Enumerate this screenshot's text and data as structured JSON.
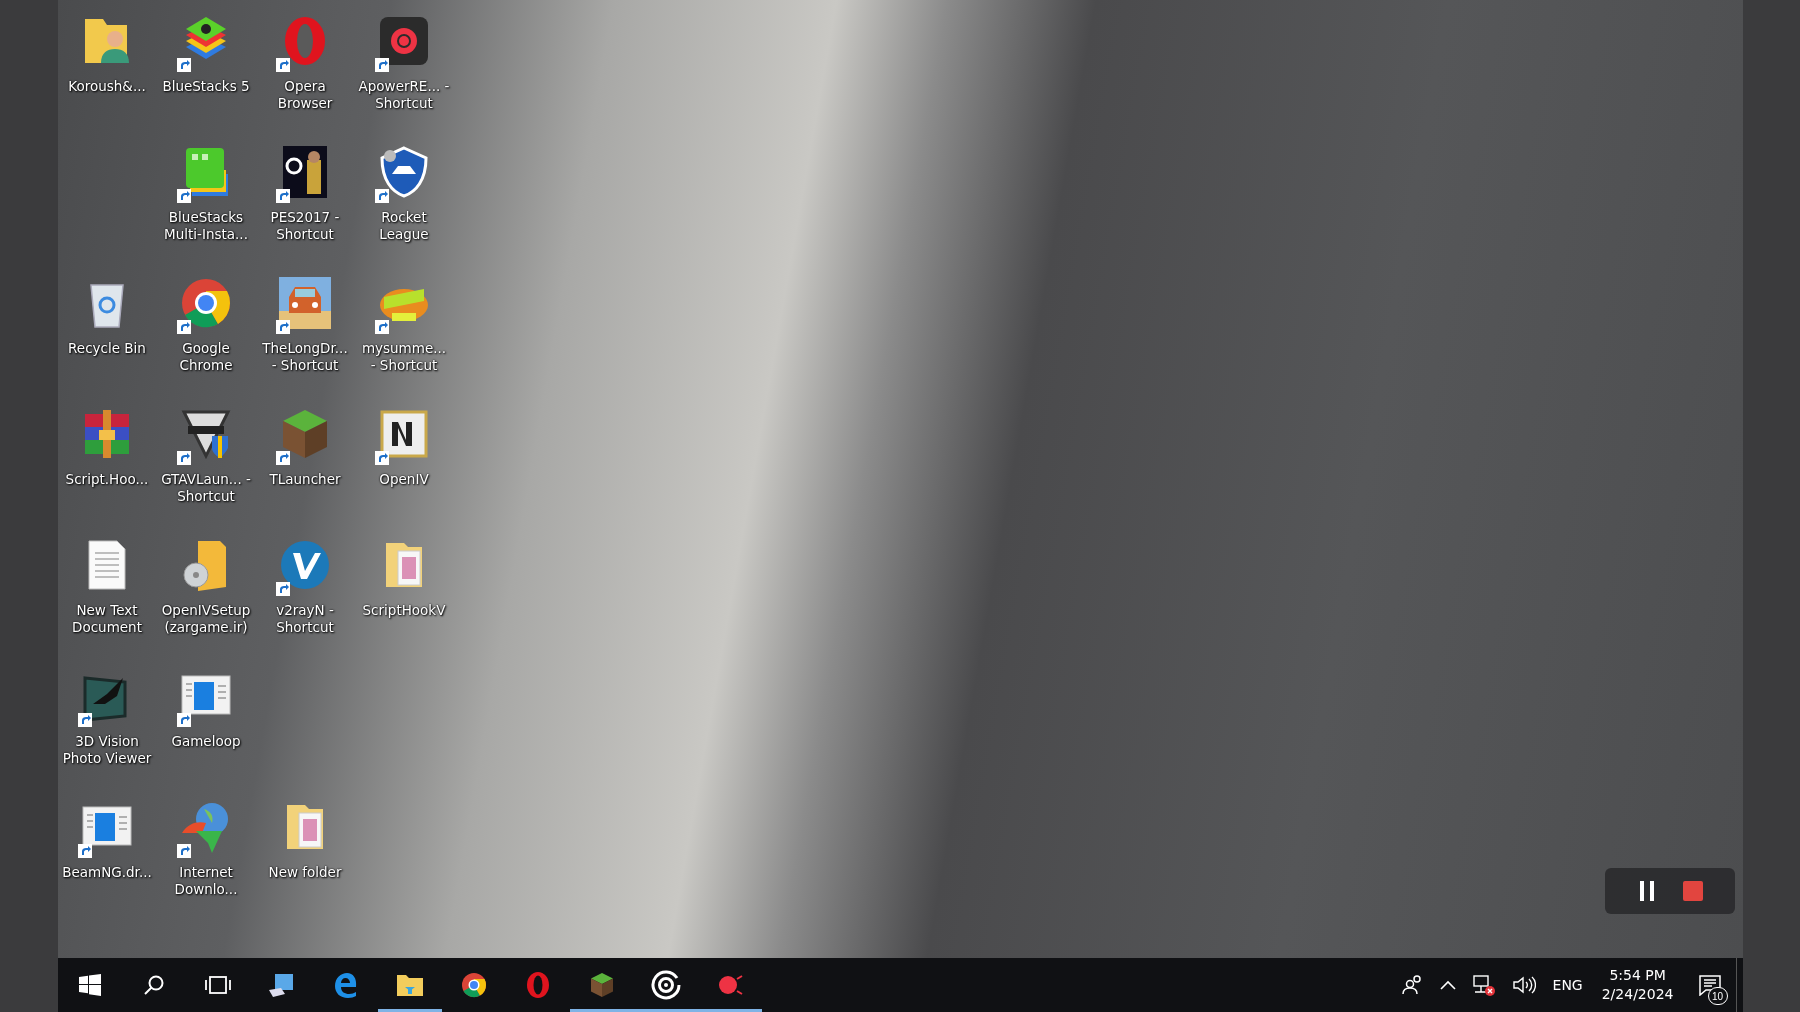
{
  "desktop": {
    "icon_rows": [
      {
        "icons": [
          {
            "kind": "user-folder",
            "label": "Koroush&...",
            "shortcut": false
          },
          {
            "kind": "stack",
            "label": "BlueStacks 5",
            "shortcut": true
          },
          {
            "kind": "ring",
            "label": "Opera Browser",
            "shortcut": true,
            "color": "#e0141e"
          },
          {
            "kind": "record",
            "label": "ApowerRE... - Shortcut",
            "shortcut": true
          }
        ]
      },
      {
        "icons": [
          {
            "kind": "empty"
          },
          {
            "kind": "tile",
            "label": "BlueStacks Multi-Insta...",
            "shortcut": true,
            "color": "#4cc92c"
          },
          {
            "kind": "poster",
            "label": "PES2017 - Shortcut",
            "shortcut": true
          },
          {
            "kind": "shield",
            "label": "Rocket League",
            "shortcut": true
          }
        ]
      },
      {
        "icons": [
          {
            "kind": "bin",
            "label": "Recycle Bin",
            "shortcut": false
          },
          {
            "kind": "chrome",
            "label": "Google Chrome",
            "shortcut": true
          },
          {
            "kind": "car",
            "label": "TheLongDr... - Shortcut",
            "shortcut": true
          },
          {
            "kind": "logo",
            "label": "mysumme... - Shortcut",
            "shortcut": true
          }
        ]
      },
      {
        "icons": [
          {
            "kind": "archive",
            "label": "Script.Hoo...",
            "shortcut": false
          },
          {
            "kind": "emblem",
            "label": "GTAVLaun... - Shortcut",
            "shortcut": true
          },
          {
            "kind": "block",
            "label": "TLauncher",
            "shortcut": true
          },
          {
            "kind": "letter-tile",
            "label": "OpenIV",
            "shortcut": true
          }
        ]
      },
      {
        "icons": [
          {
            "kind": "document",
            "label": "New Text Document",
            "shortcut": false
          },
          {
            "kind": "disc-folder",
            "label": "OpenIVSetup (zargame.ir)",
            "shortcut": false
          },
          {
            "kind": "v-circle",
            "label": "v2rayN - Shortcut",
            "shortcut": true
          },
          {
            "kind": "folder",
            "label": "ScriptHookV",
            "shortcut": false
          }
        ]
      },
      {
        "icons": [
          {
            "kind": "bird",
            "label": "3D Vision Photo Viewer",
            "shortcut": true
          },
          {
            "kind": "window",
            "label": "Gameloop",
            "shortcut": true
          }
        ]
      },
      {
        "icons": [
          {
            "kind": "window",
            "label": "BeamNG.dr...",
            "shortcut": true
          },
          {
            "kind": "globe",
            "label": "Internet Downlo...",
            "shortcut": true
          },
          {
            "kind": "folder",
            "label": "New folder",
            "shortcut": false
          }
        ]
      }
    ]
  },
  "recorder": {
    "buttons": [
      {
        "kind": "pause"
      },
      {
        "kind": "stop"
      }
    ]
  },
  "taskbar": {
    "apps": [
      {
        "kind": "start",
        "running": false
      },
      {
        "kind": "search",
        "running": false
      },
      {
        "kind": "task-view",
        "running": false
      },
      {
        "kind": "computer",
        "running": false
      },
      {
        "kind": "edge",
        "running": false
      },
      {
        "kind": "explorer",
        "running": true
      },
      {
        "kind": "chrome",
        "running": false
      },
      {
        "kind": "opera",
        "running": false
      },
      {
        "kind": "block",
        "running": true
      },
      {
        "kind": "target",
        "running": true
      },
      {
        "kind": "record",
        "running": true
      }
    ],
    "tray": {
      "language": "ENG",
      "time": "5:54 PM",
      "date": "2/24/2024",
      "notifications": "10"
    }
  }
}
